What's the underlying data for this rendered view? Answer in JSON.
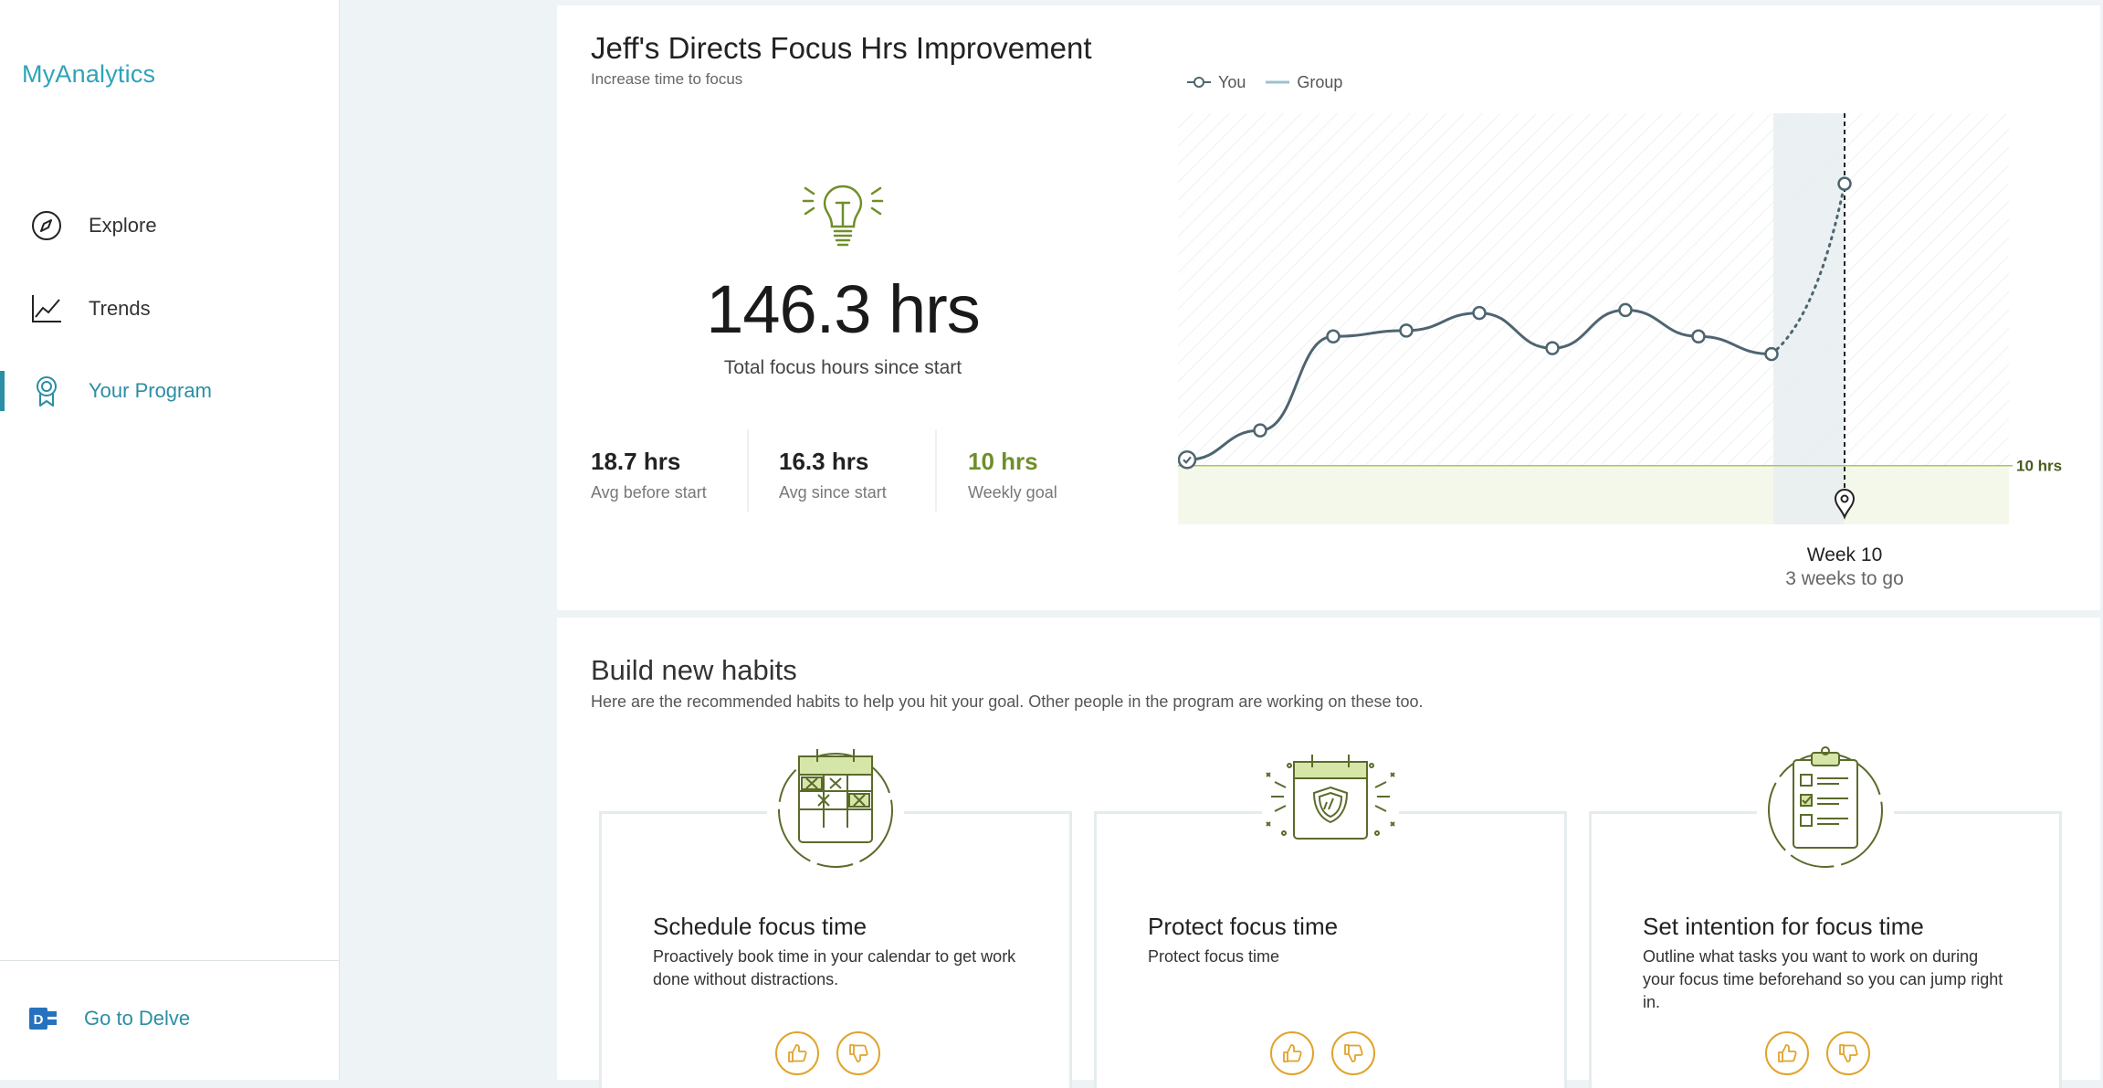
{
  "app": {
    "brand": "MyAnalytics"
  },
  "sidebar": {
    "items": [
      {
        "label": "Explore",
        "icon": "compass-icon"
      },
      {
        "label": "Trends",
        "icon": "trend-chart-icon"
      },
      {
        "label": "Your Program",
        "icon": "ribbon-award-icon",
        "active": true
      }
    ],
    "footer": {
      "label": "Go to Delve",
      "icon": "delve-icon"
    }
  },
  "program": {
    "title": "Jeff's Directs Focus Hrs Improvement",
    "subtitle": "Increase time to focus",
    "total_value": "146.3 hrs",
    "total_label": "Total focus hours since start",
    "stats": [
      {
        "value": "18.7 hrs",
        "label": "Avg before start"
      },
      {
        "value": "16.3 hrs",
        "label": "Avg since start"
      },
      {
        "value": "10 hrs",
        "label": "Weekly goal"
      }
    ]
  },
  "chart_data": {
    "type": "line",
    "legend": [
      "You",
      "Group"
    ],
    "legend_position": "top-left",
    "x": [
      1,
      2,
      3,
      4,
      5,
      6,
      7,
      8,
      9,
      10
    ],
    "series": [
      {
        "name": "You",
        "values": [
          10.2,
          11.2,
          14.4,
          14.6,
          15.2,
          14.0,
          15.3,
          14.4,
          13.8,
          19.6
        ],
        "projected_from_index": 8
      }
    ],
    "goal_line": {
      "value": 10,
      "label": "10 hrs"
    },
    "ylim": [
      8,
      22
    ],
    "current_marker": {
      "x": 10,
      "label": "Week 10",
      "sublabel": "3 weeks to go"
    },
    "colors": {
      "line": "#4e6570",
      "goal": "#a8c94e",
      "goal_fill": "#f4f8ea",
      "highlight": "#e7eef1"
    }
  },
  "habits": {
    "title": "Build new habits",
    "subtitle": "Here are the recommended habits to help you hit your goal. Other people in the program are working on these too.",
    "cards": [
      {
        "title": "Schedule focus time",
        "desc": "Proactively book time in your calendar to get work done without distractions.",
        "icon": "calendar-grid-icon"
      },
      {
        "title": "Protect focus time",
        "desc": "Protect focus time",
        "icon": "calendar-shield-icon"
      },
      {
        "title": "Set intention for focus time",
        "desc": "Outline what tasks you want to work on during your focus time beforehand so you can jump right in.",
        "icon": "clipboard-checklist-icon"
      }
    ]
  },
  "colors": {
    "accent": "#2b8ea3",
    "goal_green": "#6f8f2a",
    "vote": "#e0a42c"
  }
}
